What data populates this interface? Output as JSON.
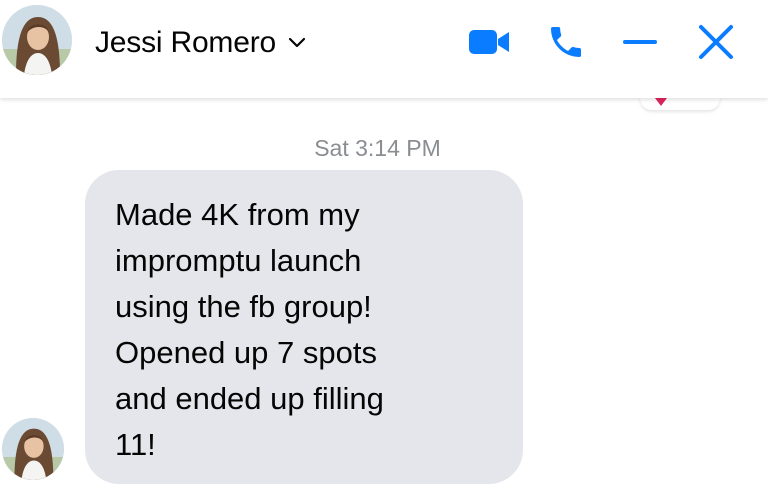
{
  "header": {
    "contact_name": "Jessi Romero",
    "avatar_icon": "profile-photo-avatar",
    "chevron_icon": "chevron-down-icon",
    "actions": [
      {
        "name": "video-call-button",
        "icon": "video-camera-icon"
      },
      {
        "name": "voice-call-button",
        "icon": "phone-icon"
      },
      {
        "name": "minimize-button",
        "icon": "minus-icon"
      },
      {
        "name": "close-button",
        "icon": "close-icon"
      }
    ],
    "accent_color": "#0a7cff"
  },
  "conversation": {
    "timestamp": "Sat 3:14 PM",
    "messages": [
      {
        "sender": "Jessi Romero",
        "text": "Made 4K from my\nimpromptu launch\nusing the fb group!\nOpened up 7 spots\nand ended up filling\n11!"
      }
    ],
    "bubble_color": "#e4e6eb"
  }
}
